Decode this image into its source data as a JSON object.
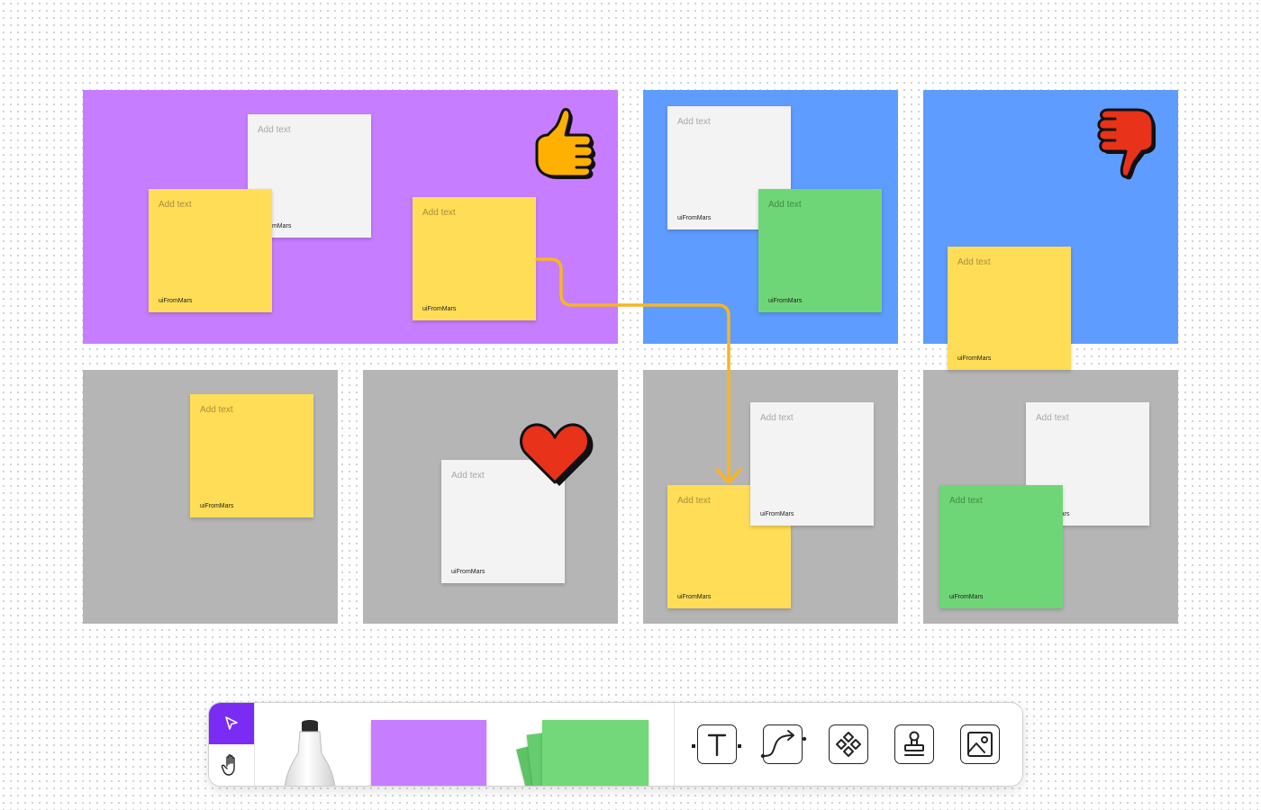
{
  "board": {
    "colors": {
      "purple": "#c77dff",
      "blue": "#5f9cff",
      "gray": "#b6b5b6",
      "yellow_note": "#ffdd57",
      "white_note": "#f3f3f3",
      "green_note": "#6fd677",
      "connector": "#f7b525",
      "accent": "#7a2cf5"
    },
    "sections": [
      "purple-section",
      "blue-section-1",
      "blue-section-2",
      "gray-section-1",
      "gray-section-2",
      "gray-section-3",
      "gray-section-4"
    ]
  },
  "notes": [
    {
      "color": "white",
      "placeholder": "Add text",
      "author": "uiFromMars"
    },
    {
      "color": "yellow",
      "placeholder": "Add text",
      "author": "uiFromMars"
    },
    {
      "color": "yellow",
      "placeholder": "Add text",
      "author": "uiFromMars"
    },
    {
      "color": "white",
      "placeholder": "Add text",
      "author": "uiFromMars"
    },
    {
      "color": "green",
      "placeholder": "Add text",
      "author": "uiFromMars"
    },
    {
      "color": "yellow",
      "placeholder": "Add text",
      "author": "uiFromMars"
    },
    {
      "color": "yellow",
      "placeholder": "Add text",
      "author": "uiFromMars"
    },
    {
      "color": "white",
      "placeholder": "Add text",
      "author": "uiFromMars"
    },
    {
      "color": "yellow",
      "placeholder": "Add text",
      "author": "uiFromMars"
    },
    {
      "color": "white",
      "placeholder": "Add text",
      "author": "uiFromMars"
    },
    {
      "color": "white",
      "placeholder": "Add text",
      "author": "uiFromMars"
    },
    {
      "color": "green",
      "placeholder": "Add text",
      "author": "uiFromMars"
    }
  ],
  "stickers": [
    "thumbs-up-icon",
    "thumbs-down-icon",
    "heart-icon"
  ],
  "toolbar": {
    "modes": [
      {
        "name": "select-tool",
        "icon": "cursor-arrow-icon",
        "active": true
      },
      {
        "name": "hand-tool",
        "icon": "hand-icon",
        "active": false
      }
    ],
    "tray": [
      "marker-icon",
      "purple-sticky-note",
      "green-sticky-note-stack"
    ],
    "tools": [
      "text-tool-icon",
      "connector-tool-icon",
      "components-tool-icon",
      "stamp-tool-icon",
      "image-tool-icon"
    ]
  }
}
